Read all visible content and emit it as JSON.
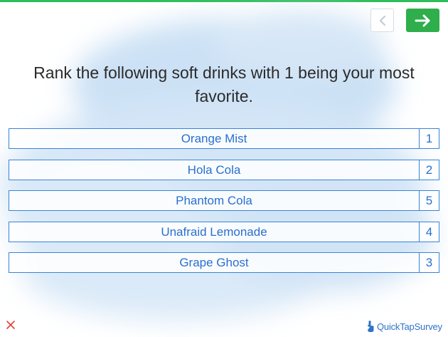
{
  "progress": {
    "fraction": 1.0,
    "color": "#2dbd5a"
  },
  "nav": {
    "back_icon": "chevron-left-icon",
    "next_icon": "arrow-right-icon"
  },
  "question": {
    "text": "Rank the following soft drinks with 1 being your most favorite."
  },
  "items": [
    {
      "label": "Orange Mist",
      "rank": "1"
    },
    {
      "label": "Hola Cola",
      "rank": "2"
    },
    {
      "label": "Phantom Cola",
      "rank": "5"
    },
    {
      "label": "Unafraid Lemonade",
      "rank": "4"
    },
    {
      "label": "Grape Ghost",
      "rank": "3"
    }
  ],
  "footer": {
    "close_icon": "close-icon",
    "brand_name": "QuickTapSurvey",
    "brand_icon": "tap-hand-icon"
  },
  "colors": {
    "accent": "#3a83d8",
    "next_button": "#2fae4c",
    "close": "#e0413a"
  }
}
